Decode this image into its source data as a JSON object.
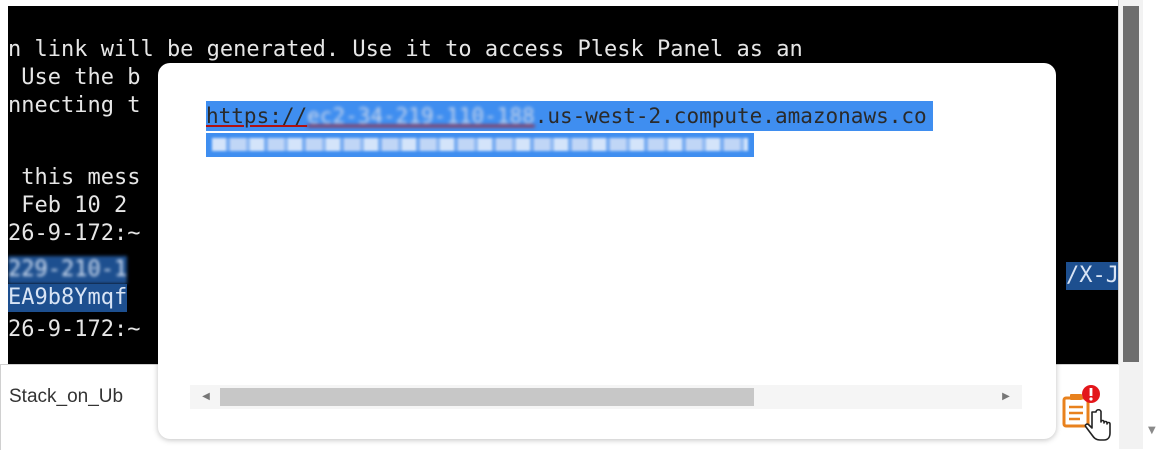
{
  "terminal": {
    "lines": [
      "n link will be generated. Use it to access Plesk Panel as an",
      " Use the b",
      "nnecting t",
      "",
      " this mess",
      " Feb 10 2",
      "26-9-172:~",
      "229-210-1",
      "EA9b8Ymqf",
      "26-9-172:~"
    ],
    "selected_right_text": "/X-J"
  },
  "dialog": {
    "url_prefix": "https://",
    "url_host_blurred": "ec2-34-219-110-188",
    "url_suffix": ".us-west-2.compute.amazonaws.co"
  },
  "bottom": {
    "file_tab_label": "Stack_on_Ub"
  },
  "icons": {
    "notes": "clipboard-notes-icon",
    "alert": "alert-badge-icon",
    "cursor": "hand-pointer-icon"
  },
  "colors": {
    "selection": "#3f8ef0",
    "terminal_bg": "#000000",
    "alert": "#e3161b",
    "notes_orange": "#e8811d"
  }
}
